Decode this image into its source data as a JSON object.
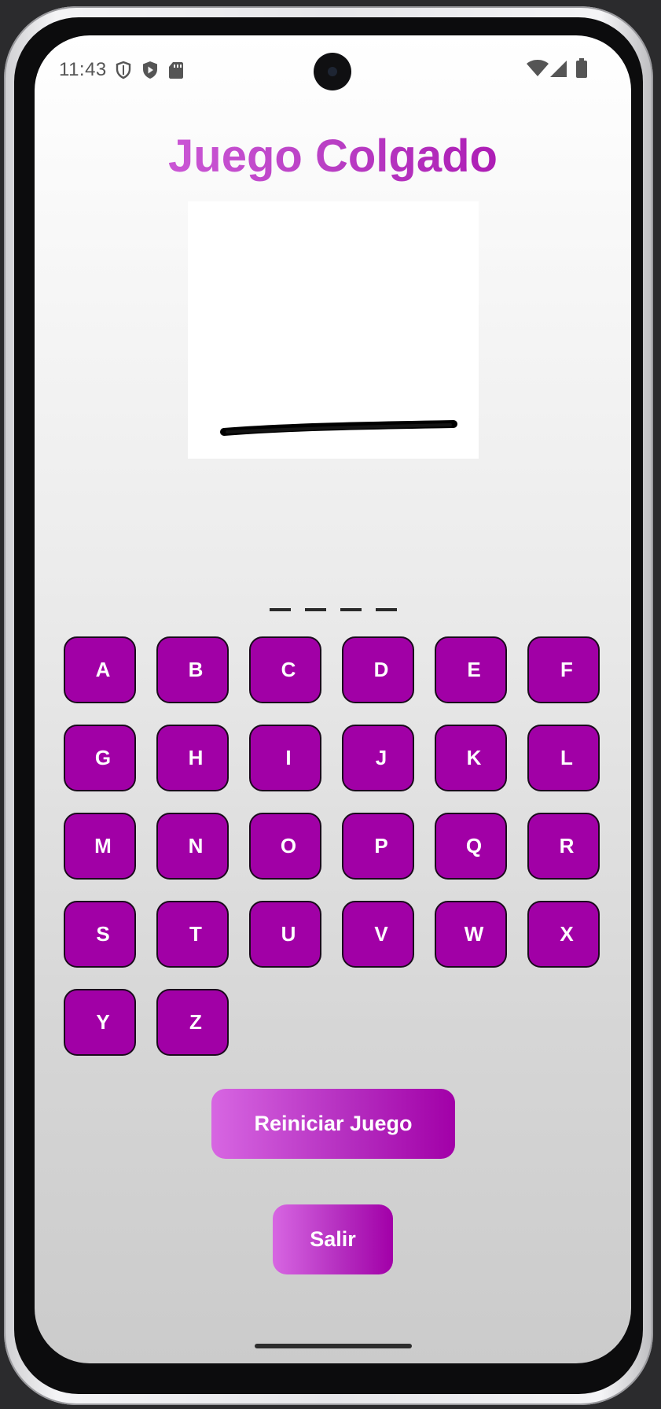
{
  "status_bar": {
    "time": "11:43",
    "left_icons": [
      "shield-outline-icon",
      "play-shield-icon",
      "sd-card-icon"
    ],
    "right_icons": [
      "wifi-icon",
      "cell-signal-icon",
      "battery-icon"
    ]
  },
  "game": {
    "title": "Juego Colgado",
    "title_gradient": [
      "#d96ae3",
      "#a300a8"
    ],
    "word_slots": 4,
    "word_display": [
      "_",
      "_",
      "_",
      "_"
    ],
    "hangman_stage": "base-only"
  },
  "keyboard": {
    "key_color": "#a100a6",
    "keys": [
      "A",
      "B",
      "C",
      "D",
      "E",
      "F",
      "G",
      "H",
      "I",
      "J",
      "K",
      "L",
      "M",
      "N",
      "O",
      "P",
      "Q",
      "R",
      "S",
      "T",
      "U",
      "V",
      "W",
      "X",
      "Y",
      "Z"
    ]
  },
  "actions": {
    "restart_label": "Reiniciar Juego",
    "exit_label": "Salir",
    "button_gradient": [
      "#d766e2",
      "#a200a8"
    ]
  }
}
